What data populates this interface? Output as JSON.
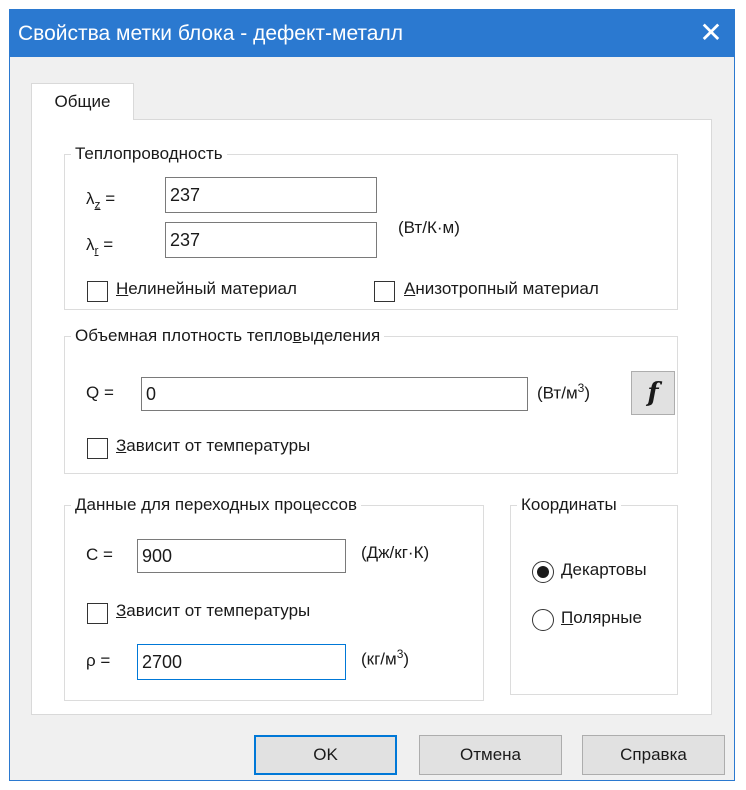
{
  "window": {
    "title": "Свойства метки блока - дефект-металл",
    "close_glyph": "✕"
  },
  "tabs": [
    {
      "label": "Общие",
      "active": true
    }
  ],
  "conductivity": {
    "legend": "Теплопроводность",
    "lz_symbol": "λ",
    "lz_sub": "z",
    "lr_symbol": "λ",
    "lr_sub": "r",
    "eq": "=",
    "lambda_z": "237",
    "lambda_r": "237",
    "unit": "(Вт/К·м)",
    "nonlinear": {
      "mnemonic": "Н",
      "rest": "елинейный материал",
      "checked": false
    },
    "anisotropic": {
      "mnemonic": "А",
      "rest": "низотропный материал",
      "checked": false
    }
  },
  "heat_generation": {
    "legend_pre": "Объемная плотность тепло",
    "legend_mnemonic": "в",
    "legend_post": "ыделения",
    "q_label": "Q =",
    "q_value": "0",
    "unit_base": "(Вт/м",
    "unit_sup": "3",
    "unit_close": ")",
    "f_button": "f",
    "temp_dep": {
      "mnemonic": "З",
      "rest": "ависит от температуры",
      "checked": false
    }
  },
  "transient": {
    "legend": "Данные для переходных процессов",
    "c_label": "C =",
    "c_value": "900",
    "c_unit": "(Дж/кг·К)",
    "temp_dep": {
      "mnemonic": "З",
      "rest": "ависит от температуры",
      "checked": false
    },
    "rho_label": "ρ =",
    "rho_value": "2700",
    "rho_unit_base": "(кг/м",
    "rho_unit_sup": "3",
    "rho_unit_close": ")"
  },
  "coordinates": {
    "legend": "Координаты",
    "options": [
      {
        "mnemonic": "Д",
        "rest": "екартовы",
        "selected": true
      },
      {
        "mnemonic": "П",
        "rest": "олярные",
        "selected": false
      }
    ]
  },
  "buttons": {
    "ok": "OK",
    "cancel": "Отмена",
    "help": "Справка"
  },
  "colors": {
    "titlebar": "#2b79d0",
    "focus": "#0078d7"
  }
}
